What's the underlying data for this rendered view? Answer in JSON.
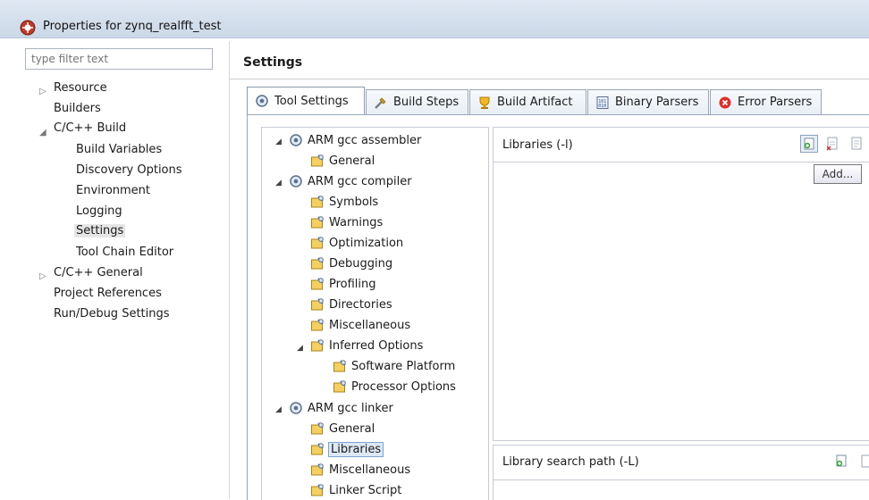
{
  "window": {
    "title": "Properties for zynq_realfft_test"
  },
  "filter": {
    "placeholder": "type filter text"
  },
  "nav": {
    "resource": "Resource",
    "builders": "Builders",
    "cpp_build": "C/C++ Build",
    "build_variables": "Build Variables",
    "discovery_options": "Discovery Options",
    "environment": "Environment",
    "logging": "Logging",
    "settings": "Settings",
    "tool_chain_editor": "Tool Chain Editor",
    "cpp_general": "C/C++ General",
    "project_references": "Project References",
    "run_debug_settings": "Run/Debug Settings"
  },
  "page": {
    "heading": "Settings"
  },
  "tabs": {
    "tool_settings": "Tool Settings",
    "build_steps": "Build Steps",
    "build_artifact": "Build Artifact",
    "binary_parsers": "Binary Parsers",
    "error_parsers": "Error Parsers"
  },
  "tools": {
    "assembler": "ARM gcc assembler",
    "assembler_general": "General",
    "compiler": "ARM gcc compiler",
    "symbols": "Symbols",
    "warnings": "Warnings",
    "optimization": "Optimization",
    "debugging": "Debugging",
    "profiling": "Profiling",
    "directories": "Directories",
    "miscellaneous": "Miscellaneous",
    "inferred_options": "Inferred Options",
    "software_platform": "Software Platform",
    "processor_options": "Processor Options",
    "linker": "ARM gcc linker",
    "linker_general": "General",
    "libraries": "Libraries",
    "linker_miscellaneous": "Miscellaneous",
    "linker_script": "Linker Script"
  },
  "libraries_panel": {
    "label": "Libraries (-l)",
    "tooltip": "Add..."
  },
  "search_path_panel": {
    "label": "Library search path (-L)"
  }
}
